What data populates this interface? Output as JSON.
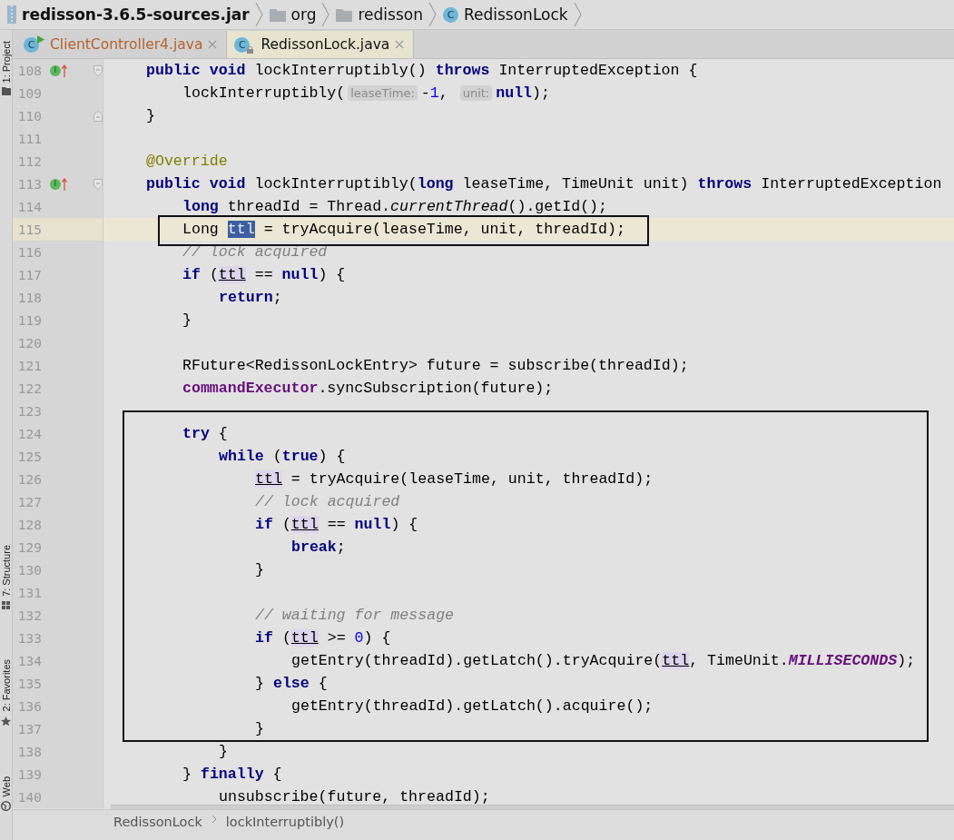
{
  "breadcrumbs": [
    {
      "text": "redisson-3.6.5-sources.jar",
      "kind": "jar"
    },
    {
      "text": "org",
      "kind": "folder"
    },
    {
      "text": "redisson",
      "kind": "folder"
    },
    {
      "text": "RedissonLock",
      "kind": "class",
      "badge": "C"
    }
  ],
  "tool_windows": [
    {
      "label": "1: Project",
      "kind": "folder"
    },
    {
      "label": "7: Structure",
      "kind": "structure"
    },
    {
      "label": "2: Favorites",
      "kind": "star"
    },
    {
      "label": "Web",
      "kind": "globe"
    }
  ],
  "tabs": [
    {
      "label": "ClientController4.java",
      "badge": "C",
      "kind": "runnable",
      "selected": false
    },
    {
      "label": "RedissonLock.java",
      "badge": "C",
      "kind": "locked",
      "selected": true
    }
  ],
  "lines": [
    {
      "number": "108",
      "current": false,
      "kind": "fold_start",
      "marker": "I",
      "tokens": [
        {
          "kind": "kw",
          "text": "public void"
        },
        {
          "kind": "plain",
          "text": " lockInterruptibly() "
        },
        {
          "kind": "kw",
          "text": "throws"
        },
        {
          "kind": "plain",
          "text": " InterruptedException {"
        }
      ],
      "children": [
        {
          "number": "109",
          "current": false,
          "tokens": [
            {
              "kind": "plain",
              "text": "lockInterruptibly("
            },
            {
              "kind": "hint",
              "text": "leaseTime:"
            },
            {
              "kind": "plain",
              "text": "-"
            },
            {
              "kind": "num",
              "text": "1"
            },
            {
              "kind": "plain",
              "text": ", "
            },
            {
              "kind": "hint",
              "text": "unit:"
            },
            {
              "kind": "kw",
              "text": "null"
            },
            {
              "kind": "plain",
              "text": ");"
            }
          ]
        }
      ]
    },
    {
      "number": "110",
      "current": false,
      "kind": "fold_end",
      "tokens": [
        {
          "kind": "plain",
          "text": "}"
        }
      ]
    },
    {
      "number": "111",
      "current": false
    },
    {
      "number": "112",
      "current": false,
      "tokens": [
        {
          "kind": "ann",
          "text": "@Override"
        }
      ]
    },
    {
      "number": "113",
      "current": false,
      "kind": "fold_start",
      "marker": "I",
      "tokens": [
        {
          "kind": "kw",
          "text": "public void"
        },
        {
          "kind": "plain",
          "text": " lockInterruptibly("
        },
        {
          "kind": "kw",
          "text": "long"
        },
        {
          "kind": "plain",
          "text": " leaseTime, TimeUnit unit) "
        },
        {
          "kind": "kw",
          "text": "throws"
        },
        {
          "kind": "plain",
          "text": " InterruptedException"
        }
      ],
      "children": [
        {
          "number": "114",
          "current": false,
          "tokens": [
            {
              "kind": "kw",
              "text": "long"
            },
            {
              "kind": "plain",
              "text": " threadId = Thread."
            },
            {
              "kind": "italic",
              "text": "currentThread"
            },
            {
              "kind": "plain",
              "text": "().getId();"
            }
          ]
        },
        {
          "number": "115",
          "current": true,
          "tokens": [
            {
              "kind": "plain",
              "text": "Long "
            },
            {
              "kind": "sel",
              "text": "ttl"
            },
            {
              "kind": "plain",
              "text": " = tryAcquire(leaseTime, unit, threadId);"
            }
          ]
        },
        {
          "number": "116",
          "current": false,
          "tokens": [
            {
              "kind": "comment",
              "text": "// lock acquired"
            }
          ]
        },
        {
          "number": "117",
          "current": false,
          "tokens": [
            {
              "kind": "kw",
              "text": "if"
            },
            {
              "kind": "plain",
              "text": " ("
            },
            {
              "kind": "usage",
              "text": "ttl"
            },
            {
              "kind": "plain",
              "text": " == "
            },
            {
              "kind": "kw",
              "text": "null"
            },
            {
              "kind": "plain",
              "text": ") {"
            }
          ],
          "children": [
            {
              "number": "118",
              "current": false,
              "tokens": [
                {
                  "kind": "kw",
                  "text": "return"
                },
                {
                  "kind": "plain",
                  "text": ";"
                }
              ]
            }
          ]
        },
        {
          "number": "119",
          "current": false,
          "tokens": [
            {
              "kind": "plain",
              "text": "}"
            }
          ]
        },
        {
          "number": "120",
          "current": false
        },
        {
          "number": "121",
          "current": false,
          "tokens": [
            {
              "kind": "plain",
              "text": "RFuture<RedissonLockEntry> future = subscribe(threadId);"
            }
          ]
        },
        {
          "number": "122",
          "current": false,
          "tokens": [
            {
              "kind": "field",
              "text": "commandExecutor"
            },
            {
              "kind": "plain",
              "text": ".syncSubscription(future);"
            }
          ]
        },
        {
          "number": "123",
          "current": false
        },
        {
          "number": "124",
          "current": false,
          "tokens": [
            {
              "kind": "kw",
              "text": "try"
            },
            {
              "kind": "plain",
              "text": " {"
            }
          ],
          "children": [
            {
              "number": "125",
              "current": false,
              "tokens": [
                {
                  "kind": "kw",
                  "text": "while"
                },
                {
                  "kind": "plain",
                  "text": " ("
                },
                {
                  "kind": "kw",
                  "text": "true"
                },
                {
                  "kind": "plain",
                  "text": ") {"
                }
              ],
              "children": [
                {
                  "number": "126",
                  "current": false,
                  "tokens": [
                    {
                      "kind": "usage",
                      "text": "ttl"
                    },
                    {
                      "kind": "plain",
                      "text": " = tryAcquire(leaseTime, unit, threadId);"
                    }
                  ]
                },
                {
                  "number": "127",
                  "current": false,
                  "tokens": [
                    {
                      "kind": "comment",
                      "text": "// lock acquired"
                    }
                  ]
                },
                {
                  "number": "128",
                  "current": false,
                  "tokens": [
                    {
                      "kind": "kw",
                      "text": "if"
                    },
                    {
                      "kind": "plain",
                      "text": " ("
                    },
                    {
                      "kind": "usage",
                      "text": "ttl"
                    },
                    {
                      "kind": "plain",
                      "text": " == "
                    },
                    {
                      "kind": "kw",
                      "text": "null"
                    },
                    {
                      "kind": "plain",
                      "text": ") {"
                    }
                  ],
                  "children": [
                    {
                      "number": "129",
                      "current": false,
                      "tokens": [
                        {
                          "kind": "kw",
                          "text": "break"
                        },
                        {
                          "kind": "plain",
                          "text": ";"
                        }
                      ]
                    }
                  ]
                },
                {
                  "number": "130",
                  "current": false,
                  "tokens": [
                    {
                      "kind": "plain",
                      "text": "}"
                    }
                  ]
                },
                {
                  "number": "131",
                  "current": false
                },
                {
                  "number": "132",
                  "current": false,
                  "tokens": [
                    {
                      "kind": "comment",
                      "text": "// waiting for message"
                    }
                  ]
                },
                {
                  "number": "133",
                  "current": false,
                  "tokens": [
                    {
                      "kind": "kw",
                      "text": "if"
                    },
                    {
                      "kind": "plain",
                      "text": " ("
                    },
                    {
                      "kind": "usage",
                      "text": "ttl"
                    },
                    {
                      "kind": "plain",
                      "text": " >= "
                    },
                    {
                      "kind": "num",
                      "text": "0"
                    },
                    {
                      "kind": "plain",
                      "text": ") {"
                    }
                  ],
                  "children": [
                    {
                      "number": "134",
                      "current": false,
                      "tokens": [
                        {
                          "kind": "plain",
                          "text": "getEntry(threadId).getLatch().tryAcquire("
                        },
                        {
                          "kind": "usage",
                          "text": "ttl"
                        },
                        {
                          "kind": "plain",
                          "text": ", TimeUnit."
                        },
                        {
                          "kind": "static",
                          "text": "MILLISECONDS"
                        },
                        {
                          "kind": "plain",
                          "text": ");"
                        }
                      ]
                    }
                  ]
                },
                {
                  "number": "135",
                  "current": false,
                  "tokens": [
                    {
                      "kind": "plain",
                      "text": "} "
                    },
                    {
                      "kind": "kw",
                      "text": "else"
                    },
                    {
                      "kind": "plain",
                      "text": " {"
                    }
                  ],
                  "children": [
                    {
                      "number": "136",
                      "current": false,
                      "tokens": [
                        {
                          "kind": "plain",
                          "text": "getEntry(threadId).getLatch().acquire();"
                        }
                      ]
                    }
                  ]
                },
                {
                  "number": "137",
                  "current": false,
                  "tokens": [
                    {
                      "kind": "plain",
                      "text": "}"
                    }
                  ]
                }
              ]
            },
            {
              "number": "138",
              "current": false,
              "tokens": [
                {
                  "kind": "plain",
                  "text": "}"
                }
              ]
            }
          ]
        },
        {
          "number": "139",
          "current": false,
          "tokens": [
            {
              "kind": "plain",
              "text": "} "
            },
            {
              "kind": "kw",
              "text": "finally"
            },
            {
              "kind": "plain",
              "text": " {"
            }
          ],
          "children": [
            {
              "number": "140",
              "current": false,
              "tokens": [
                {
                  "kind": "plain",
                  "text": "unsubscribe(future, threadId);"
                }
              ]
            }
          ]
        }
      ]
    }
  ],
  "status_breadcrumbs": [
    "RedissonLock",
    "lockInterruptibly()"
  ]
}
